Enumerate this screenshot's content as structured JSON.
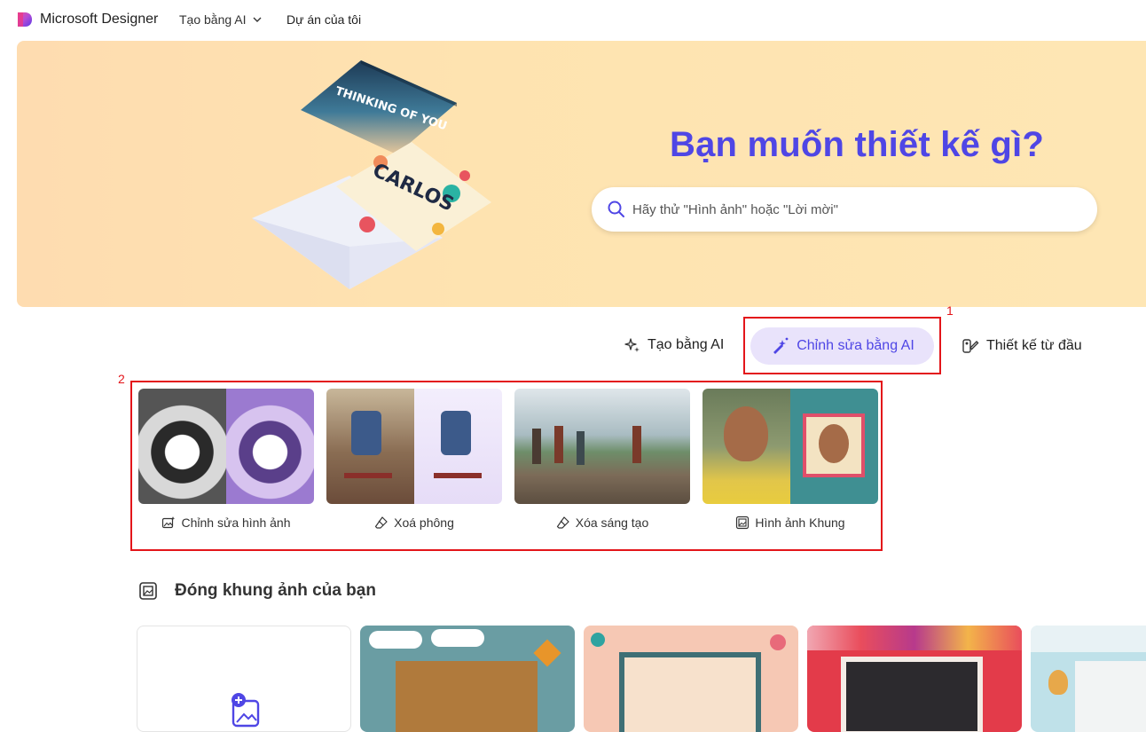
{
  "nav": {
    "brand": "Microsoft Designer",
    "create_ai": "Tạo bằng AI",
    "my_projects": "Dự án của tôi"
  },
  "hero": {
    "title": "Bạn muốn thiết kế gì?",
    "search_placeholder": "Hãy thử \"Hình ảnh\" hoặc \"Lời mời\""
  },
  "modes": {
    "create_ai": "Tạo bằng AI",
    "edit_ai": "Chỉnh sửa bằng AI",
    "from_scratch": "Thiết kế từ đầu"
  },
  "annotations": {
    "box1": "1",
    "box2": "2"
  },
  "tools": [
    {
      "label": "Chỉnh sửa hình ảnh",
      "icon": "image-sparkle-icon"
    },
    {
      "label": "Xoá phông",
      "icon": "eraser-icon"
    },
    {
      "label": "Xóa sáng tạo",
      "icon": "eraser-icon"
    },
    {
      "label": "Hình ảnh Khung",
      "icon": "frame-icon"
    }
  ],
  "section": {
    "title": "Đóng khung ảnh của bạn"
  },
  "colors": {
    "accent": "#4f46e5",
    "accent_bg": "#e9e3fb",
    "hero_bg": "#fee3b0",
    "annotation": "#e3151a"
  }
}
